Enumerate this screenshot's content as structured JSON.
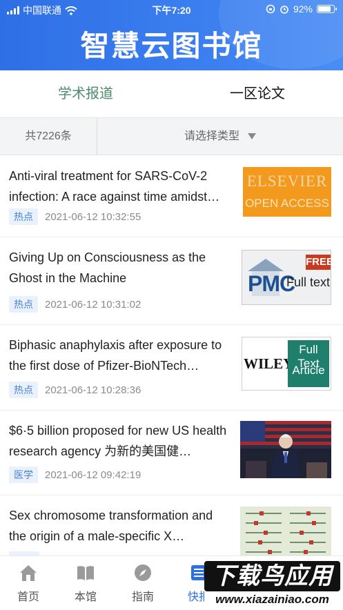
{
  "status_bar": {
    "carrier": "中国联通",
    "time": "下午7:20",
    "battery": "92%",
    "battery_level": 0.92
  },
  "header": {
    "title": "智慧云图书馆"
  },
  "tabs": [
    {
      "label": "学术报道",
      "active": true
    },
    {
      "label": "一区论文",
      "active": false
    }
  ],
  "filter": {
    "count": "共7226条",
    "type_placeholder": "请选择类型"
  },
  "articles": [
    {
      "title": "Anti-viral treatment for SARS-CoV-2 infection: A race against time amidst…",
      "tag": "热点",
      "date": "2021-06-12 10:32:55",
      "thumb": "elsevier-open-access"
    },
    {
      "title": "Giving Up on Consciousness as the Ghost in the Machine",
      "tag": "热点",
      "date": "2021-06-12 10:31:02",
      "thumb": "pmc-free-full-text"
    },
    {
      "title": "Biphasic anaphylaxis after exposure to the first dose of Pfizer-BioNTech…",
      "tag": "热点",
      "date": "2021-06-12 10:28:36",
      "thumb": "wiley-full-text-article"
    },
    {
      "title": "$6·5 billion proposed for new US health research agency 为新的美国健…",
      "tag": "医学",
      "date": "2021-06-12 09:42:19",
      "thumb": "speech-photo"
    },
    {
      "title": "Sex chromosome transformation and the origin of a male-specific X…",
      "tag": "",
      "date": "",
      "thumb": "chromosome-diagram"
    }
  ],
  "thumbs": {
    "elsevier": {
      "line1": "ELSEVIER",
      "line2": "OPEN ACCESS"
    },
    "pmc": {
      "logo": "PMC",
      "free": "FREE",
      "full": "Full text"
    },
    "wiley": {
      "logo": "WILEY",
      "line1": "Full Text",
      "line2": "Article"
    }
  },
  "nav": [
    {
      "label": "首页",
      "icon": "home-icon",
      "active": false
    },
    {
      "label": "本馆",
      "icon": "book-icon",
      "active": false
    },
    {
      "label": "指南",
      "icon": "compass-icon",
      "active": false
    },
    {
      "label": "快报",
      "icon": "news-icon",
      "active": true
    }
  ],
  "watermark": {
    "cn": "下载鸟应用",
    "url": "www.xiazainiao.com"
  },
  "colors": {
    "header": "#2f6fe6",
    "active_tab": "#4f8a6f",
    "badge_bg": "#e9f1fc",
    "badge_text": "#4a82d6"
  }
}
